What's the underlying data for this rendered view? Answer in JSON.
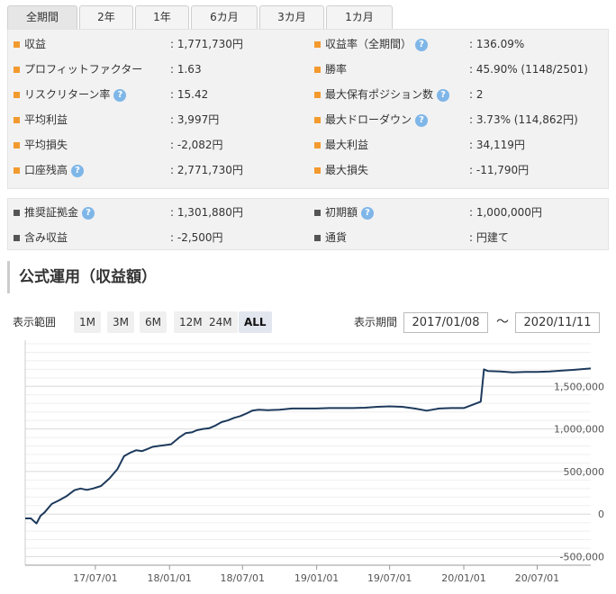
{
  "tabs": [
    "全期間",
    "2年",
    "1年",
    "6カ月",
    "3カ月",
    "1カ月"
  ],
  "stats_left": [
    {
      "label": "収益",
      "value": ": 1,771,730円",
      "help": false
    },
    {
      "label": "プロフィットファクター",
      "value": ": 1.63",
      "help": false
    },
    {
      "label": "リスクリターン率",
      "value": ": 15.42",
      "help": true
    },
    {
      "label": "平均利益",
      "value": ": 3,997円",
      "help": false
    },
    {
      "label": "平均損失",
      "value": ": -2,082円",
      "help": false
    },
    {
      "label": "口座残高",
      "value": ": 2,771,730円",
      "help": true
    }
  ],
  "stats_right": [
    {
      "label": "収益率（全期間）",
      "value": ": 136.09%",
      "help": true
    },
    {
      "label": "勝率",
      "value": ": 45.90% (1148/2501)",
      "help": false
    },
    {
      "label": "最大保有ポジション数",
      "value": ": 2",
      "help": true
    },
    {
      "label": "最大ドローダウン",
      "value": ": 3.73% (114,862円)",
      "help": true
    },
    {
      "label": "最大利益",
      "value": ": 34,119円",
      "help": false
    },
    {
      "label": "最大損失",
      "value": ": -11,790円",
      "help": false
    }
  ],
  "stats2_left": [
    {
      "label": "推奨証拠金",
      "value": ": 1,301,880円",
      "help": true
    },
    {
      "label": "含み収益",
      "value": ": -2,500円",
      "help": false
    }
  ],
  "stats2_right": [
    {
      "label": "初期額",
      "value": ": 1,000,000円",
      "help": true
    },
    {
      "label": "通貨",
      "value": ": 円建て",
      "help": false
    }
  ],
  "help_glyph": "?",
  "section_title": "公式運用（収益額）",
  "controls": {
    "range_label": "表示範囲",
    "ranges": [
      "1M",
      "3M",
      "6M",
      "12M",
      "24M",
      "ALL"
    ],
    "active_range": "ALL",
    "period_label": "表示期間",
    "date_from": "2017/01/08",
    "tilde": "〜",
    "date_to": "2020/11/11"
  },
  "colors": {
    "line": "#1d3a5c",
    "accent": "#f39a2f",
    "help": "#7fb6e8"
  },
  "chart_data": {
    "type": "line",
    "x_ticks": [
      "17/07/01",
      "18/01/01",
      "18/07/01",
      "19/01/01",
      "19/07/01",
      "20/01/01",
      "20/07/01"
    ],
    "y_ticks": [
      "-500,000",
      "0",
      "500,000",
      "1,000,000",
      "1,500,000"
    ],
    "ylim": [
      -600000,
      2000000
    ],
    "xlim": [
      "2017-01-08",
      "2020-11-11"
    ],
    "series": [
      {
        "x": [
          "2017-01-08",
          "2017-01-22",
          "2017-02-05",
          "2017-02-15",
          "2017-02-25",
          "2017-03-15",
          "2017-04-01",
          "2017-04-20",
          "2017-05-10",
          "2017-05-25",
          "2017-06-10",
          "2017-06-25",
          "2017-07-15",
          "2017-08-05",
          "2017-08-25",
          "2017-09-10",
          "2017-09-25",
          "2017-10-10",
          "2017-10-25",
          "2017-11-05",
          "2017-11-20",
          "2017-12-05",
          "2017-12-20",
          "2018-01-05",
          "2018-01-25",
          "2018-02-10",
          "2018-02-25",
          "2018-03-10",
          "2018-03-25",
          "2018-04-10",
          "2018-04-25",
          "2018-05-10",
          "2018-05-25",
          "2018-06-10",
          "2018-06-25",
          "2018-07-10",
          "2018-07-25",
          "2018-08-10",
          "2018-09-01",
          "2018-10-01",
          "2018-11-01",
          "2018-12-01",
          "2019-01-01",
          "2019-02-01",
          "2019-03-01",
          "2019-04-01",
          "2019-05-01",
          "2019-06-01",
          "2019-07-01",
          "2019-08-01",
          "2019-09-01",
          "2019-10-01",
          "2019-11-01",
          "2019-12-01",
          "2020-01-01",
          "2020-02-01",
          "2020-02-12",
          "2020-02-20",
          "2020-03-01",
          "2020-04-01",
          "2020-05-01",
          "2020-06-01",
          "2020-07-01",
          "2020-08-01",
          "2020-09-01",
          "2020-10-01",
          "2020-11-11"
        ],
        "y": [
          -50000,
          -50000,
          -110000,
          -20000,
          20000,
          120000,
          160000,
          210000,
          280000,
          300000,
          285000,
          300000,
          330000,
          420000,
          530000,
          680000,
          720000,
          750000,
          740000,
          760000,
          790000,
          800000,
          810000,
          820000,
          900000,
          950000,
          960000,
          985000,
          1000000,
          1010000,
          1040000,
          1080000,
          1100000,
          1130000,
          1150000,
          1180000,
          1215000,
          1225000,
          1220000,
          1225000,
          1240000,
          1240000,
          1240000,
          1245000,
          1245000,
          1245000,
          1250000,
          1260000,
          1265000,
          1260000,
          1240000,
          1215000,
          1240000,
          1245000,
          1245000,
          1300000,
          1320000,
          1700000,
          1680000,
          1675000,
          1665000,
          1670000,
          1670000,
          1675000,
          1685000,
          1695000,
          1710000
        ]
      }
    ]
  }
}
